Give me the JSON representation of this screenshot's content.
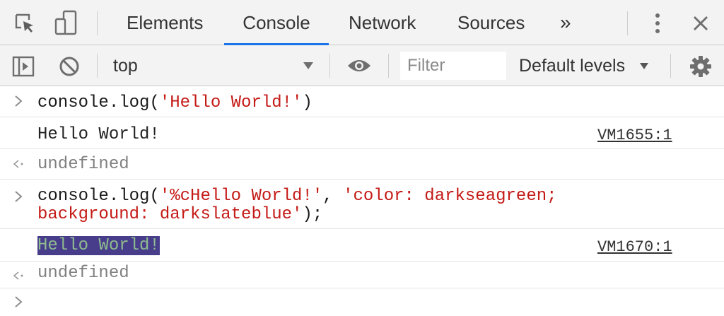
{
  "tabs": {
    "elements": "Elements",
    "console": "Console",
    "network": "Network",
    "sources": "Sources",
    "more": "»"
  },
  "toolbar": {
    "context": "top",
    "filter_placeholder": "Filter",
    "levels": "Default levels"
  },
  "console": {
    "line1_fn": "console.log(",
    "line1_str": "'Hello World!'",
    "line1_end": ")",
    "log1_text": "Hello World!",
    "log1_source": "VM1655:1",
    "result1": "undefined",
    "line2_fn": "console.log(",
    "line2_str1": "'%cHello World!'",
    "line2_sep": ", ",
    "line2_str2a": "'color: darkseagreen;",
    "line2_str2b": "background: darkslateblue'",
    "line2_end": ");",
    "log2_text": "Hello World!",
    "log2_source": "VM1670:1",
    "result2": "undefined"
  },
  "colors": {
    "accent_tab": "#1a73e8",
    "string": "#c41a16",
    "styled_bg": "darkslateblue",
    "styled_fg": "darkseagreen"
  },
  "icons": [
    "inspect-element-icon",
    "device-toolbar-icon",
    "more-tabs-chevron-icon",
    "kebab-menu-icon",
    "close-icon",
    "sidebar-toggle-icon",
    "clear-console-icon",
    "dropdown-arrow-icon",
    "eye-icon",
    "settings-gear-icon",
    "input-prompt-icon",
    "result-arrow-icon"
  ]
}
